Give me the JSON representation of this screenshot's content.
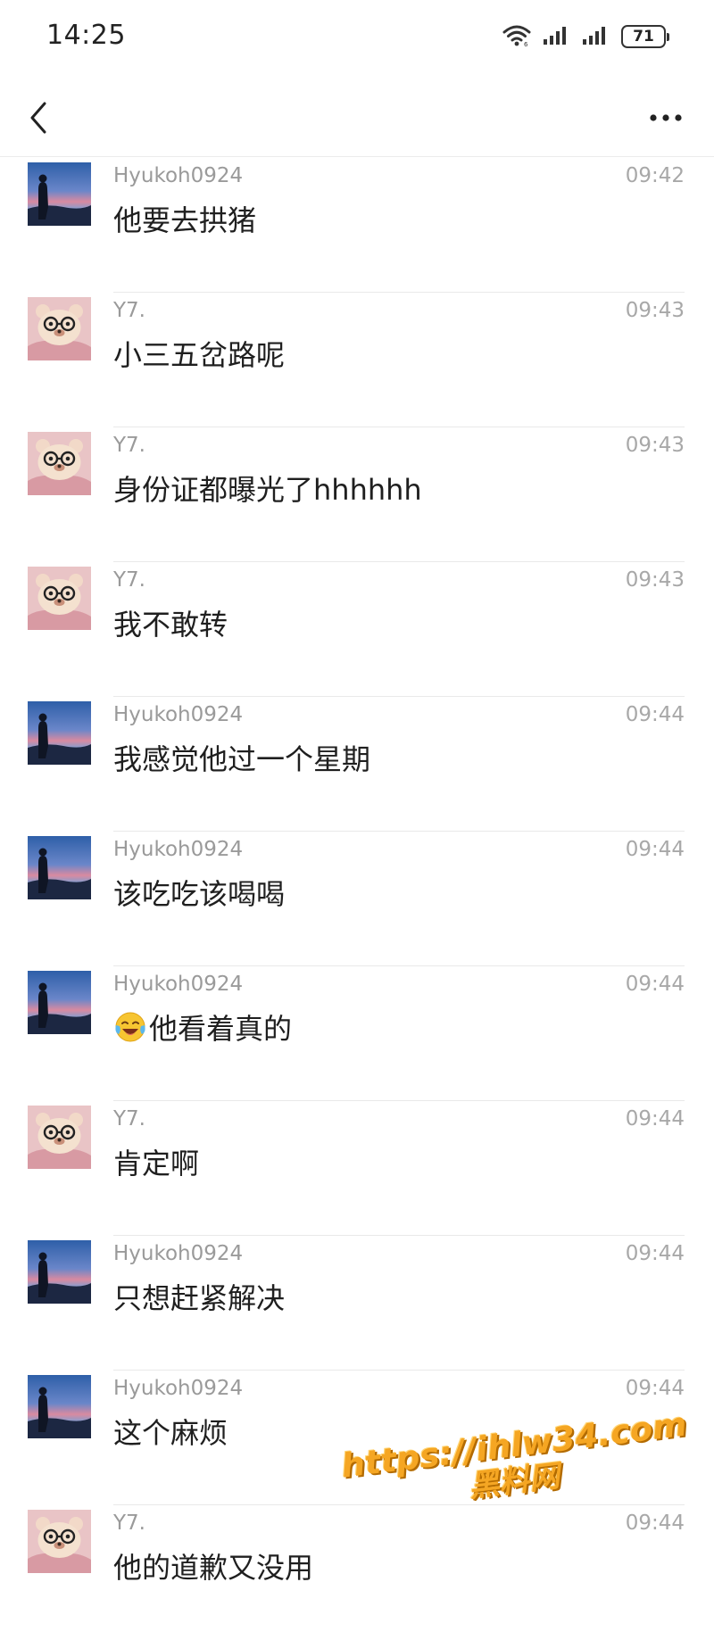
{
  "status_bar": {
    "time": "14:25",
    "battery": "71",
    "icons": [
      "wifi-icon",
      "signal-icon",
      "signal-icon",
      "battery-icon"
    ]
  },
  "nav": {
    "back_icon": "chevron-left-icon",
    "more_icon": "more-horizontal-icon"
  },
  "messages": [
    {
      "sender": "Hyukoh0924",
      "time": "09:42",
      "text": "他要去拱猪",
      "avatar": "landscape"
    },
    {
      "sender": "Y7.",
      "time": "09:43",
      "text": "小三五岔路呢",
      "avatar": "bear"
    },
    {
      "sender": "Y7.",
      "time": "09:43",
      "text": "身份证都曝光了hhhhhh",
      "avatar": "bear"
    },
    {
      "sender": "Y7.",
      "time": "09:43",
      "text": "我不敢转",
      "avatar": "bear"
    },
    {
      "sender": "Hyukoh0924",
      "time": "09:44",
      "text": "我感觉他过一个星期",
      "avatar": "landscape"
    },
    {
      "sender": "Hyukoh0924",
      "time": "09:44",
      "text": "该吃吃该喝喝",
      "avatar": "landscape"
    },
    {
      "sender": "Hyukoh0924",
      "time": "09:44",
      "text": "他看着真的",
      "avatar": "landscape",
      "emoji": "tears-of-joy-emoji"
    },
    {
      "sender": "Y7.",
      "time": "09:44",
      "text": "肯定啊",
      "avatar": "bear"
    },
    {
      "sender": "Hyukoh0924",
      "time": "09:44",
      "text": "只想赶紧解决",
      "avatar": "landscape"
    },
    {
      "sender": "Hyukoh0924",
      "time": "09:44",
      "text": "这个麻烦",
      "avatar": "landscape"
    },
    {
      "sender": "Y7.",
      "time": "09:44",
      "text": "他的道歉又没用",
      "avatar": "bear"
    }
  ],
  "watermark": {
    "url": "https://ihlw34.com",
    "name": "黑料网"
  },
  "colors": {
    "sender": "#9a9a9a",
    "timestamp": "#a8a8a8",
    "message_text": "#1f1f1f",
    "divider": "#e9e9e9",
    "watermark": "#f5a623"
  }
}
